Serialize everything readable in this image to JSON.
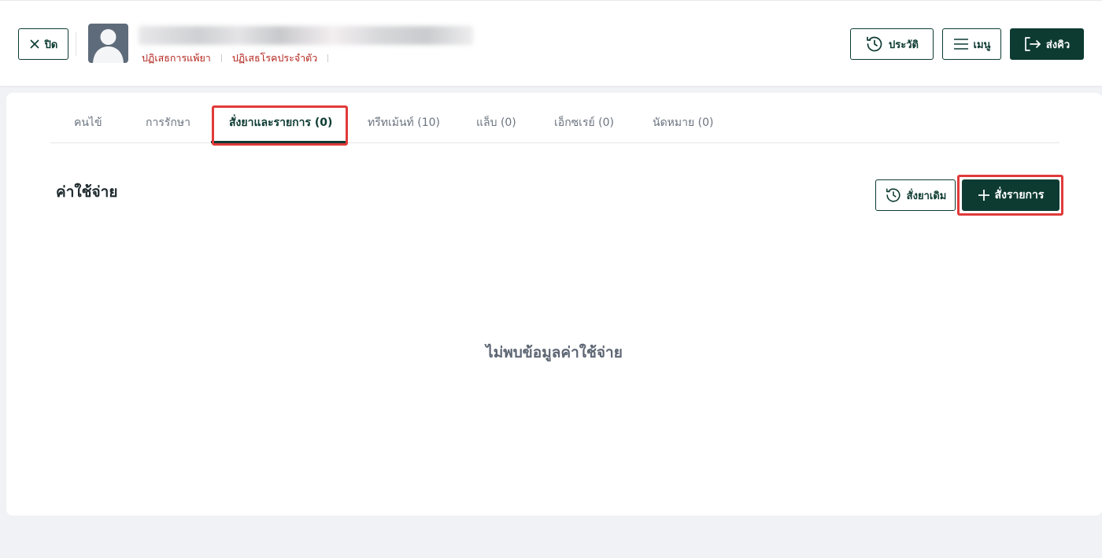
{
  "header": {
    "close_label": "ปิด",
    "allergies": [
      "ปฏิเสธการแพ้ยา",
      "ปฏิเสธโรคประจำตัว"
    ],
    "history_label": "ประวัติ",
    "menu_label": "เมนู",
    "send_queue_label": "ส่งคิว"
  },
  "tabs": [
    {
      "label": "คนไข้"
    },
    {
      "label": "การรักษา"
    },
    {
      "label": "สั่งยาและรายการ (0)"
    },
    {
      "label": "ทรีทเม้นท์ (10)"
    },
    {
      "label": "แล็บ (0)"
    },
    {
      "label": "เอ็กซเรย์ (0)"
    },
    {
      "label": "นัดหมาย (0)"
    }
  ],
  "active_tab_index": 2,
  "section": {
    "title": "ค่าใช้จ่าย",
    "previous_order_label": "สั่งยาเดิม",
    "new_order_label": "สั่งรายการ",
    "empty_message": "ไม่พบข้อมูลค่าใช้จ่าย"
  },
  "colors": {
    "primary": "#0d3b32",
    "allergy_text": "#b3261e",
    "highlight": "#e03a3a",
    "background": "#f0f2f5"
  }
}
